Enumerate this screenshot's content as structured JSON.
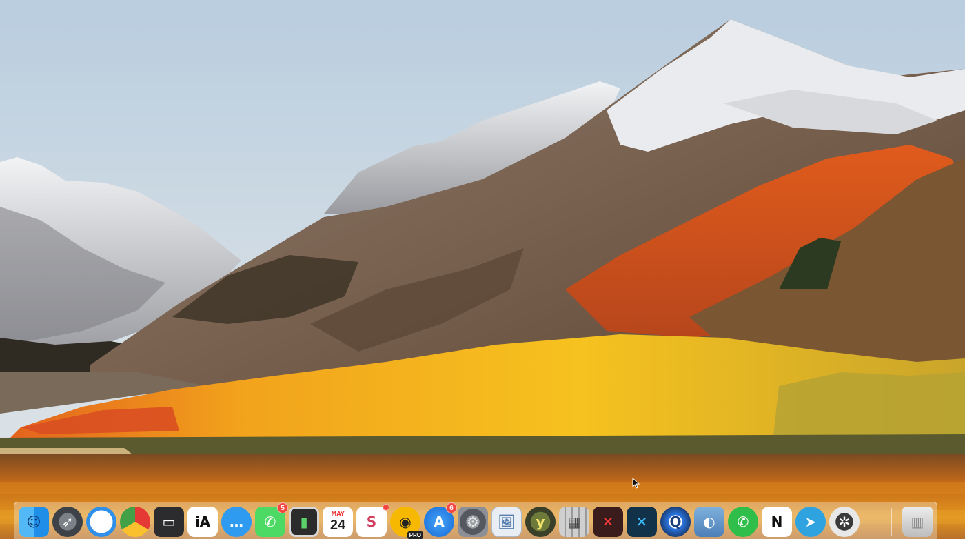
{
  "desktop": {
    "wallpaper_name": "macos-high-sierra-wallpaper",
    "sky_color": "#c7d7e4",
    "foliage_color": "#f0a21a",
    "lake_color": "#b5651d"
  },
  "dock": {
    "apps": [
      {
        "name": "finder",
        "icon": "finder-icon"
      },
      {
        "name": "launchpad",
        "icon": "rocket-icon"
      },
      {
        "name": "airmail",
        "icon": "envelope-icon"
      },
      {
        "name": "chrome",
        "icon": "chrome-icon"
      },
      {
        "name": "wallet",
        "icon": "wallet-icon"
      },
      {
        "name": "ia-writer",
        "icon": "ia-writer-icon",
        "label": "iA"
      },
      {
        "name": "messages",
        "icon": "speech-bubble-icon"
      },
      {
        "name": "facetime",
        "icon": "phone-video-icon",
        "badge": "5"
      },
      {
        "name": "sidenotes",
        "icon": "green-notes-icon"
      },
      {
        "name": "calendar",
        "icon": "calendar-icon",
        "month": "MAY",
        "day": "24"
      },
      {
        "name": "slack",
        "icon": "slack-icon",
        "label": "S",
        "badge_dot": true
      },
      {
        "name": "vectorize",
        "icon": "yellow-eye-icon",
        "pro": "PRO"
      },
      {
        "name": "app-store",
        "icon": "app-store-icon",
        "badge": "6"
      },
      {
        "name": "system-preferences",
        "icon": "gear-icon"
      },
      {
        "name": "preview",
        "icon": "preview-icon"
      },
      {
        "name": "yoink",
        "icon": "yoink-icon",
        "label": "y"
      },
      {
        "name": "calculator",
        "icon": "calculator-icon"
      },
      {
        "name": "toggl-red",
        "icon": "red-x-icon"
      },
      {
        "name": "toggl-blue",
        "icon": "blue-x-icon"
      },
      {
        "name": "quicktime",
        "icon": "quicktime-icon"
      },
      {
        "name": "image-capture",
        "icon": "image-capture-icon"
      },
      {
        "name": "whatsapp",
        "icon": "whatsapp-icon"
      },
      {
        "name": "notion",
        "icon": "notion-icon",
        "label": "N"
      },
      {
        "name": "telegram",
        "icon": "paper-plane-icon"
      },
      {
        "name": "final-cut",
        "icon": "clapper-icon"
      },
      {
        "name": "trash",
        "icon": "trash-icon"
      }
    ]
  }
}
